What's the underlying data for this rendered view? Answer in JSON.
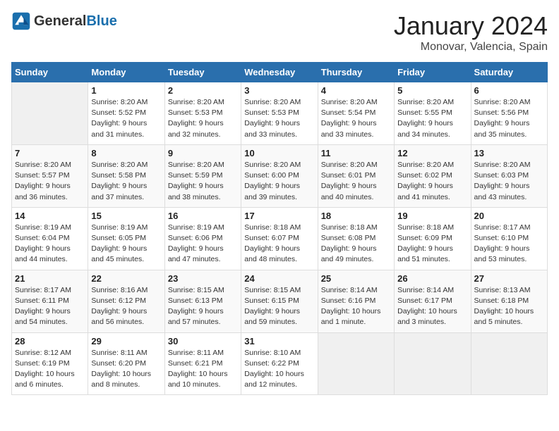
{
  "header": {
    "logo_general": "General",
    "logo_blue": "Blue",
    "month": "January 2024",
    "location": "Monovar, Valencia, Spain"
  },
  "weekdays": [
    "Sunday",
    "Monday",
    "Tuesday",
    "Wednesday",
    "Thursday",
    "Friday",
    "Saturday"
  ],
  "weeks": [
    [
      {
        "day": "",
        "info": ""
      },
      {
        "day": "1",
        "info": "Sunrise: 8:20 AM\nSunset: 5:52 PM\nDaylight: 9 hours\nand 31 minutes."
      },
      {
        "day": "2",
        "info": "Sunrise: 8:20 AM\nSunset: 5:53 PM\nDaylight: 9 hours\nand 32 minutes."
      },
      {
        "day": "3",
        "info": "Sunrise: 8:20 AM\nSunset: 5:53 PM\nDaylight: 9 hours\nand 33 minutes."
      },
      {
        "day": "4",
        "info": "Sunrise: 8:20 AM\nSunset: 5:54 PM\nDaylight: 9 hours\nand 33 minutes."
      },
      {
        "day": "5",
        "info": "Sunrise: 8:20 AM\nSunset: 5:55 PM\nDaylight: 9 hours\nand 34 minutes."
      },
      {
        "day": "6",
        "info": "Sunrise: 8:20 AM\nSunset: 5:56 PM\nDaylight: 9 hours\nand 35 minutes."
      }
    ],
    [
      {
        "day": "7",
        "info": "Sunrise: 8:20 AM\nSunset: 5:57 PM\nDaylight: 9 hours\nand 36 minutes."
      },
      {
        "day": "8",
        "info": "Sunrise: 8:20 AM\nSunset: 5:58 PM\nDaylight: 9 hours\nand 37 minutes."
      },
      {
        "day": "9",
        "info": "Sunrise: 8:20 AM\nSunset: 5:59 PM\nDaylight: 9 hours\nand 38 minutes."
      },
      {
        "day": "10",
        "info": "Sunrise: 8:20 AM\nSunset: 6:00 PM\nDaylight: 9 hours\nand 39 minutes."
      },
      {
        "day": "11",
        "info": "Sunrise: 8:20 AM\nSunset: 6:01 PM\nDaylight: 9 hours\nand 40 minutes."
      },
      {
        "day": "12",
        "info": "Sunrise: 8:20 AM\nSunset: 6:02 PM\nDaylight: 9 hours\nand 41 minutes."
      },
      {
        "day": "13",
        "info": "Sunrise: 8:20 AM\nSunset: 6:03 PM\nDaylight: 9 hours\nand 43 minutes."
      }
    ],
    [
      {
        "day": "14",
        "info": "Sunrise: 8:19 AM\nSunset: 6:04 PM\nDaylight: 9 hours\nand 44 minutes."
      },
      {
        "day": "15",
        "info": "Sunrise: 8:19 AM\nSunset: 6:05 PM\nDaylight: 9 hours\nand 45 minutes."
      },
      {
        "day": "16",
        "info": "Sunrise: 8:19 AM\nSunset: 6:06 PM\nDaylight: 9 hours\nand 47 minutes."
      },
      {
        "day": "17",
        "info": "Sunrise: 8:18 AM\nSunset: 6:07 PM\nDaylight: 9 hours\nand 48 minutes."
      },
      {
        "day": "18",
        "info": "Sunrise: 8:18 AM\nSunset: 6:08 PM\nDaylight: 9 hours\nand 49 minutes."
      },
      {
        "day": "19",
        "info": "Sunrise: 8:18 AM\nSunset: 6:09 PM\nDaylight: 9 hours\nand 51 minutes."
      },
      {
        "day": "20",
        "info": "Sunrise: 8:17 AM\nSunset: 6:10 PM\nDaylight: 9 hours\nand 53 minutes."
      }
    ],
    [
      {
        "day": "21",
        "info": "Sunrise: 8:17 AM\nSunset: 6:11 PM\nDaylight: 9 hours\nand 54 minutes."
      },
      {
        "day": "22",
        "info": "Sunrise: 8:16 AM\nSunset: 6:12 PM\nDaylight: 9 hours\nand 56 minutes."
      },
      {
        "day": "23",
        "info": "Sunrise: 8:15 AM\nSunset: 6:13 PM\nDaylight: 9 hours\nand 57 minutes."
      },
      {
        "day": "24",
        "info": "Sunrise: 8:15 AM\nSunset: 6:15 PM\nDaylight: 9 hours\nand 59 minutes."
      },
      {
        "day": "25",
        "info": "Sunrise: 8:14 AM\nSunset: 6:16 PM\nDaylight: 10 hours\nand 1 minute."
      },
      {
        "day": "26",
        "info": "Sunrise: 8:14 AM\nSunset: 6:17 PM\nDaylight: 10 hours\nand 3 minutes."
      },
      {
        "day": "27",
        "info": "Sunrise: 8:13 AM\nSunset: 6:18 PM\nDaylight: 10 hours\nand 5 minutes."
      }
    ],
    [
      {
        "day": "28",
        "info": "Sunrise: 8:12 AM\nSunset: 6:19 PM\nDaylight: 10 hours\nand 6 minutes."
      },
      {
        "day": "29",
        "info": "Sunrise: 8:11 AM\nSunset: 6:20 PM\nDaylight: 10 hours\nand 8 minutes."
      },
      {
        "day": "30",
        "info": "Sunrise: 8:11 AM\nSunset: 6:21 PM\nDaylight: 10 hours\nand 10 minutes."
      },
      {
        "day": "31",
        "info": "Sunrise: 8:10 AM\nSunset: 6:22 PM\nDaylight: 10 hours\nand 12 minutes."
      },
      {
        "day": "",
        "info": ""
      },
      {
        "day": "",
        "info": ""
      },
      {
        "day": "",
        "info": ""
      }
    ]
  ]
}
